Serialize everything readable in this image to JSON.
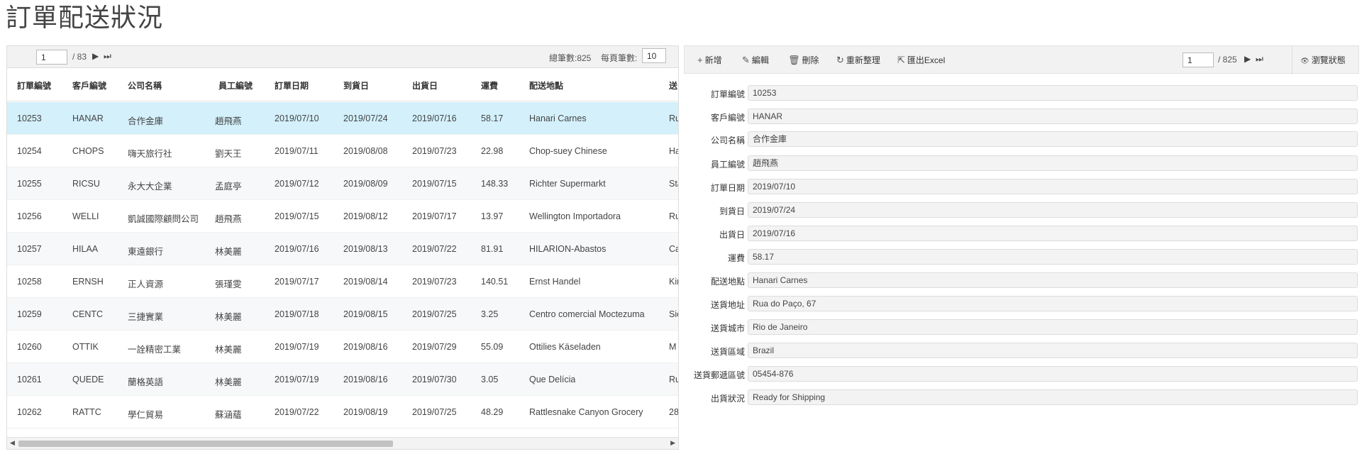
{
  "page": {
    "title": "訂單配送狀況"
  },
  "grid": {
    "pager": {
      "current_page": "1",
      "total_pages": "/ 83",
      "next": "▶",
      "last": "⏭"
    },
    "total_label": "總筆數:825",
    "page_size_label": "每頁筆數:",
    "page_size": "10",
    "columns": [
      "訂單編號",
      "客戶編號",
      "公司名稱",
      "員工編號",
      "訂單日期",
      "到貨日",
      "出貨日",
      "運費",
      "配送地點",
      "送"
    ],
    "rows": [
      {
        "cells": [
          "10253",
          "HANAR",
          "合作金庫",
          "趙飛燕",
          "2019/07/10",
          "2019/07/24",
          "2019/07/16",
          "58.17",
          "Hanari Carnes",
          "Ru"
        ]
      },
      {
        "cells": [
          "10254",
          "CHOPS",
          "嗨天旅行社",
          "劉天王",
          "2019/07/11",
          "2019/08/08",
          "2019/07/23",
          "22.98",
          "Chop-suey Chinese",
          "Ha"
        ]
      },
      {
        "cells": [
          "10255",
          "RICSU",
          "永大大企業",
          "孟庭亭",
          "2019/07/12",
          "2019/08/09",
          "2019/07/15",
          "148.33",
          "Richter Supermarkt",
          "Sta"
        ]
      },
      {
        "cells": [
          "10256",
          "WELLI",
          "凱誠國際顧問公司",
          "趙飛燕",
          "2019/07/15",
          "2019/08/12",
          "2019/07/17",
          "13.97",
          "Wellington Importadora",
          "Ru"
        ]
      },
      {
        "cells": [
          "10257",
          "HILAA",
          "東遠銀行",
          "林美麗",
          "2019/07/16",
          "2019/08/13",
          "2019/07/22",
          "81.91",
          "HILARION-Abastos",
          "Ca"
        ]
      },
      {
        "cells": [
          "10258",
          "ERNSH",
          "正人資源",
          "張瑾雯",
          "2019/07/17",
          "2019/08/14",
          "2019/07/23",
          "140.51",
          "Ernst Handel",
          "Kir"
        ]
      },
      {
        "cells": [
          "10259",
          "CENTC",
          "三捷實業",
          "林美麗",
          "2019/07/18",
          "2019/08/15",
          "2019/07/25",
          "3.25",
          "Centro comercial Moctezuma",
          "Sie"
        ]
      },
      {
        "cells": [
          "10260",
          "OTTIK",
          "一詮精密工業",
          "林美麗",
          "2019/07/19",
          "2019/08/16",
          "2019/07/29",
          "55.09",
          "Ottilies Käseladen",
          "M"
        ]
      },
      {
        "cells": [
          "10261",
          "QUEDE",
          "蘭格英語",
          "林美麗",
          "2019/07/19",
          "2019/08/16",
          "2019/07/30",
          "3.05",
          "Que Delícia",
          "Ru"
        ]
      },
      {
        "cells": [
          "10262",
          "RATTC",
          "學仁貿易",
          "蘇涵蘊",
          "2019/07/22",
          "2019/08/19",
          "2019/07/25",
          "48.29",
          "Rattlesnake Canyon Grocery",
          "28"
        ]
      }
    ],
    "scroll_left": "◀",
    "scroll_right": "▶"
  },
  "form": {
    "toolbar": {
      "add": "新增",
      "add_icon": "+",
      "edit": "編輯",
      "edit_icon": "✎",
      "delete": "刪除",
      "delete_icon": "🗑",
      "refresh": "重新整理",
      "refresh_icon": "↻",
      "export": "匯出Excel",
      "export_icon": "⇱",
      "current_page": "1",
      "total_pages": "/ 825",
      "next": "▶",
      "last": "⏭",
      "browse": "瀏覽狀態",
      "browse_icon": "👁"
    },
    "fields": [
      {
        "label": "訂單編號",
        "value": "10253"
      },
      {
        "label": "客戶編號",
        "value": "HANAR"
      },
      {
        "label": "公司名稱",
        "value": "合作金庫"
      },
      {
        "label": "員工編號",
        "value": "趙飛燕"
      },
      {
        "label": "訂單日期",
        "value": "2019/07/10"
      },
      {
        "label": "到貨日",
        "value": "2019/07/24"
      },
      {
        "label": "出貨日",
        "value": "2019/07/16"
      },
      {
        "label": "運費",
        "value": "58.17"
      },
      {
        "label": "配送地點",
        "value": "Hanari Carnes"
      },
      {
        "label": "送貨地址",
        "value": "Rua do Paço, 67"
      },
      {
        "label": "送貨城市",
        "value": "Rio de Janeiro"
      },
      {
        "label": "送貨區域",
        "value": "Brazil"
      },
      {
        "label": "送貨郵遞區號",
        "value": "05454-876"
      },
      {
        "label": "出貨狀況",
        "value": "Ready for Shipping"
      }
    ]
  },
  "colors": {
    "selected_row": "#d3f0fb",
    "alt_row": "#f6f8f9",
    "toolbar_bg": "#f2f2f2"
  }
}
